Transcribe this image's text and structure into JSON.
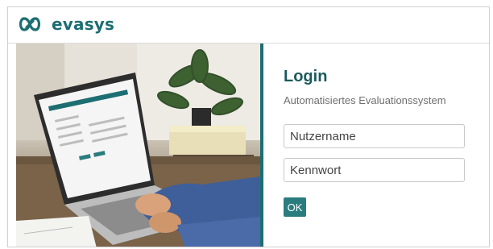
{
  "brand": {
    "name": "evasys",
    "color": "#1c6e72"
  },
  "login": {
    "title": "Login",
    "subtitle": "Automatisiertes Evaluationssystem",
    "username_placeholder": "Nutzername",
    "password_placeholder": "Kennwort",
    "submit_label": "OK"
  },
  "icons": {
    "logo": "evasys-infinity-logo-icon"
  }
}
